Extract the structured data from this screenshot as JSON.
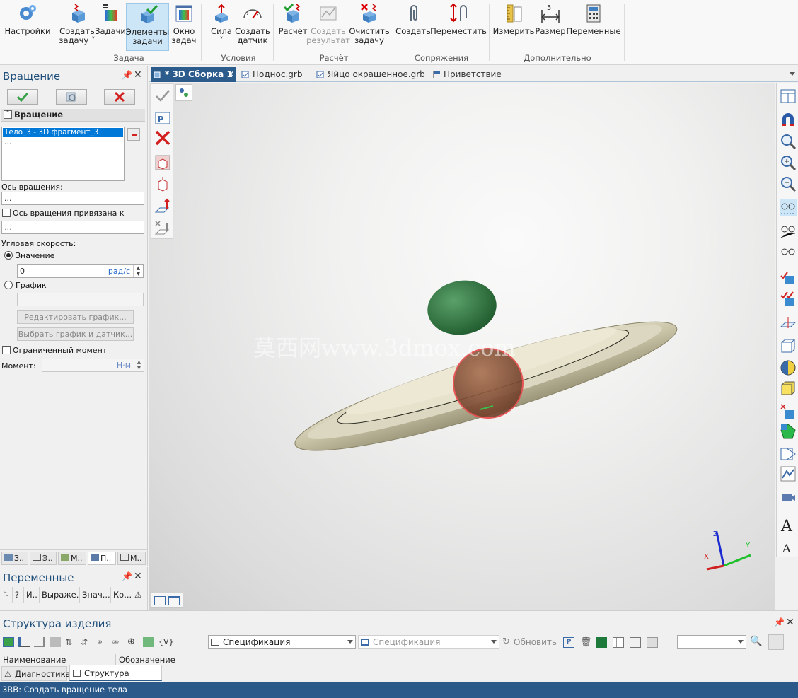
{
  "ribbon": {
    "buttons": [
      {
        "id": "settings",
        "label": "Настройки"
      },
      {
        "id": "create_task",
        "label": "Создать\nзадачу ˅"
      },
      {
        "id": "tasks",
        "label": "Задачи"
      },
      {
        "id": "task_elements",
        "label": "Элементы\nзадачи"
      },
      {
        "id": "task_window",
        "label": "Окно\nзадач"
      },
      {
        "id": "force",
        "label": "Сила\n˅"
      },
      {
        "id": "create_sensor",
        "label": "Создать\nдатчик"
      },
      {
        "id": "calculate",
        "label": "Расчёт"
      },
      {
        "id": "create_result",
        "label": "Создать\nрезультат"
      },
      {
        "id": "clear_task",
        "label": "Очистить\nзадачу"
      },
      {
        "id": "create_mate",
        "label": "Создать"
      },
      {
        "id": "move",
        "label": "Переместить"
      },
      {
        "id": "measure",
        "label": "Измерить"
      },
      {
        "id": "dimension",
        "label": "Размер"
      },
      {
        "id": "variables",
        "label": "Переменные"
      }
    ],
    "groups": {
      "task": "Задача",
      "conditions": "Условия",
      "calc": "Расчёт",
      "mates": "Сопряжения",
      "extra": "Дополнительно"
    }
  },
  "left_panel": {
    "title": "Вращение",
    "section": "Вращение",
    "selected_item": "Тело_3 - 3D фрагмент_3",
    "list_more": "...",
    "axis_label": "Ось вращения:",
    "axis_value": "...",
    "axis_bound_label": "Ось вращения привязана к телу:",
    "axis_bound_value": "...",
    "angular_speed_label": "Угловая скорость:",
    "value_radio": "Значение",
    "speed_value": "0",
    "speed_unit": "рад/с",
    "graph_radio": "График",
    "edit_graph_btn": "Редактировать график...",
    "choose_graph_btn": "Выбрать график и датчик...",
    "limited_moment": "Ограниченный момент",
    "moment_label": "Момент:",
    "moment_unit": "Н·м",
    "tabs": [
      "З..",
      "Э..",
      "М..",
      "П..",
      "М.."
    ]
  },
  "variables_panel": {
    "title": "Переменные",
    "columns": [
      "?",
      "И..",
      "Выраже...",
      "Знач...",
      "Ко..."
    ]
  },
  "doc_tabs": [
    "* 3D Сборка 1",
    "Поднос.grb",
    "Яйцо окрашенное.grb",
    "Приветствие"
  ],
  "viewport": {
    "watermark": "莫西网www.3dmox.com",
    "axes": {
      "x": "X",
      "y": "Y",
      "z": "Z"
    }
  },
  "bottom_panel": {
    "title": "Структура изделия",
    "spec_left": "Спецификация",
    "spec_right": "Спецификация",
    "refresh": "Обновить",
    "columns": [
      "Наименование",
      "Обозначение"
    ],
    "tabs": [
      "Диагностика",
      "Структура изделия"
    ]
  },
  "status": "3RB: Создать вращение тела"
}
